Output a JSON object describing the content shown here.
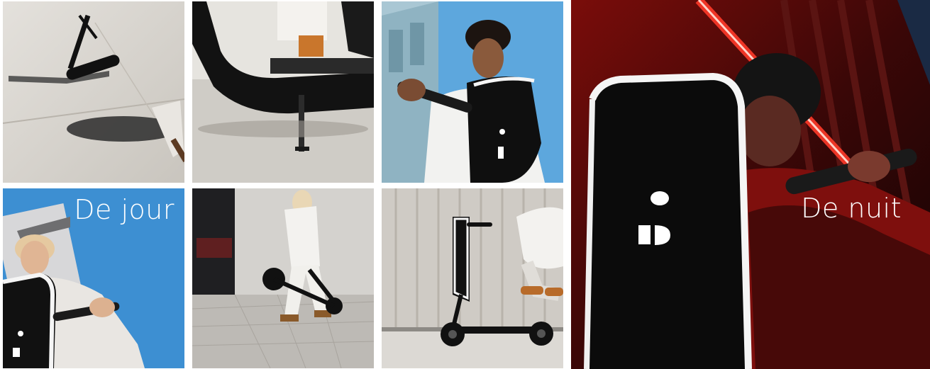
{
  "gallery": {
    "captions": {
      "day": "De jour",
      "night": "De nuit"
    },
    "tiles": [
      {
        "subject": "scooter-shadow-on-pavement"
      },
      {
        "subject": "scooter-deck-and-kickstand"
      },
      {
        "subject": "rider-with-scooter-handlebar"
      },
      {
        "subject": "woman-riding-scooter-daylight"
      },
      {
        "subject": "person-carrying-folded-scooter"
      },
      {
        "subject": "scooter-parked-rider-jumping"
      },
      {
        "subject": "rider-scooter-at-night-red-light"
      }
    ],
    "colors": {
      "sky": "#3f8fd0",
      "concrete": "#d8d5cf",
      "scooter": "#111111",
      "night_red": "#c0140e"
    }
  }
}
